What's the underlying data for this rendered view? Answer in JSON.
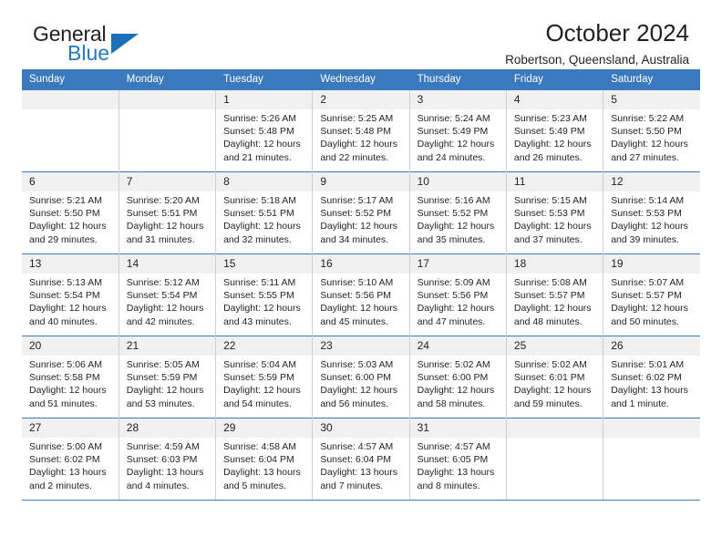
{
  "brand": {
    "name_part1": "General",
    "name_part2": "Blue",
    "accent_color": "#1a6fb5"
  },
  "header": {
    "title": "October 2024",
    "subtitle": "Robertson, Queensland, Australia"
  },
  "theme": {
    "header_row_color": "#3a79bd",
    "daynum_band_color": "#f0f0f0",
    "text_color": "#231f20"
  },
  "weekday_headers": [
    "Sunday",
    "Monday",
    "Tuesday",
    "Wednesday",
    "Thursday",
    "Friday",
    "Saturday"
  ],
  "weeks": [
    [
      {
        "day": "",
        "sunrise": "",
        "sunset": "",
        "daylight_line1": "",
        "daylight_line2": ""
      },
      {
        "day": "",
        "sunrise": "",
        "sunset": "",
        "daylight_line1": "",
        "daylight_line2": ""
      },
      {
        "day": "1",
        "sunrise": "Sunrise: 5:26 AM",
        "sunset": "Sunset: 5:48 PM",
        "daylight_line1": "Daylight: 12 hours",
        "daylight_line2": "and 21 minutes."
      },
      {
        "day": "2",
        "sunrise": "Sunrise: 5:25 AM",
        "sunset": "Sunset: 5:48 PM",
        "daylight_line1": "Daylight: 12 hours",
        "daylight_line2": "and 22 minutes."
      },
      {
        "day": "3",
        "sunrise": "Sunrise: 5:24 AM",
        "sunset": "Sunset: 5:49 PM",
        "daylight_line1": "Daylight: 12 hours",
        "daylight_line2": "and 24 minutes."
      },
      {
        "day": "4",
        "sunrise": "Sunrise: 5:23 AM",
        "sunset": "Sunset: 5:49 PM",
        "daylight_line1": "Daylight: 12 hours",
        "daylight_line2": "and 26 minutes."
      },
      {
        "day": "5",
        "sunrise": "Sunrise: 5:22 AM",
        "sunset": "Sunset: 5:50 PM",
        "daylight_line1": "Daylight: 12 hours",
        "daylight_line2": "and 27 minutes."
      }
    ],
    [
      {
        "day": "6",
        "sunrise": "Sunrise: 5:21 AM",
        "sunset": "Sunset: 5:50 PM",
        "daylight_line1": "Daylight: 12 hours",
        "daylight_line2": "and 29 minutes."
      },
      {
        "day": "7",
        "sunrise": "Sunrise: 5:20 AM",
        "sunset": "Sunset: 5:51 PM",
        "daylight_line1": "Daylight: 12 hours",
        "daylight_line2": "and 31 minutes."
      },
      {
        "day": "8",
        "sunrise": "Sunrise: 5:18 AM",
        "sunset": "Sunset: 5:51 PM",
        "daylight_line1": "Daylight: 12 hours",
        "daylight_line2": "and 32 minutes."
      },
      {
        "day": "9",
        "sunrise": "Sunrise: 5:17 AM",
        "sunset": "Sunset: 5:52 PM",
        "daylight_line1": "Daylight: 12 hours",
        "daylight_line2": "and 34 minutes."
      },
      {
        "day": "10",
        "sunrise": "Sunrise: 5:16 AM",
        "sunset": "Sunset: 5:52 PM",
        "daylight_line1": "Daylight: 12 hours",
        "daylight_line2": "and 35 minutes."
      },
      {
        "day": "11",
        "sunrise": "Sunrise: 5:15 AM",
        "sunset": "Sunset: 5:53 PM",
        "daylight_line1": "Daylight: 12 hours",
        "daylight_line2": "and 37 minutes."
      },
      {
        "day": "12",
        "sunrise": "Sunrise: 5:14 AM",
        "sunset": "Sunset: 5:53 PM",
        "daylight_line1": "Daylight: 12 hours",
        "daylight_line2": "and 39 minutes."
      }
    ],
    [
      {
        "day": "13",
        "sunrise": "Sunrise: 5:13 AM",
        "sunset": "Sunset: 5:54 PM",
        "daylight_line1": "Daylight: 12 hours",
        "daylight_line2": "and 40 minutes."
      },
      {
        "day": "14",
        "sunrise": "Sunrise: 5:12 AM",
        "sunset": "Sunset: 5:54 PM",
        "daylight_line1": "Daylight: 12 hours",
        "daylight_line2": "and 42 minutes."
      },
      {
        "day": "15",
        "sunrise": "Sunrise: 5:11 AM",
        "sunset": "Sunset: 5:55 PM",
        "daylight_line1": "Daylight: 12 hours",
        "daylight_line2": "and 43 minutes."
      },
      {
        "day": "16",
        "sunrise": "Sunrise: 5:10 AM",
        "sunset": "Sunset: 5:56 PM",
        "daylight_line1": "Daylight: 12 hours",
        "daylight_line2": "and 45 minutes."
      },
      {
        "day": "17",
        "sunrise": "Sunrise: 5:09 AM",
        "sunset": "Sunset: 5:56 PM",
        "daylight_line1": "Daylight: 12 hours",
        "daylight_line2": "and 47 minutes."
      },
      {
        "day": "18",
        "sunrise": "Sunrise: 5:08 AM",
        "sunset": "Sunset: 5:57 PM",
        "daylight_line1": "Daylight: 12 hours",
        "daylight_line2": "and 48 minutes."
      },
      {
        "day": "19",
        "sunrise": "Sunrise: 5:07 AM",
        "sunset": "Sunset: 5:57 PM",
        "daylight_line1": "Daylight: 12 hours",
        "daylight_line2": "and 50 minutes."
      }
    ],
    [
      {
        "day": "20",
        "sunrise": "Sunrise: 5:06 AM",
        "sunset": "Sunset: 5:58 PM",
        "daylight_line1": "Daylight: 12 hours",
        "daylight_line2": "and 51 minutes."
      },
      {
        "day": "21",
        "sunrise": "Sunrise: 5:05 AM",
        "sunset": "Sunset: 5:59 PM",
        "daylight_line1": "Daylight: 12 hours",
        "daylight_line2": "and 53 minutes."
      },
      {
        "day": "22",
        "sunrise": "Sunrise: 5:04 AM",
        "sunset": "Sunset: 5:59 PM",
        "daylight_line1": "Daylight: 12 hours",
        "daylight_line2": "and 54 minutes."
      },
      {
        "day": "23",
        "sunrise": "Sunrise: 5:03 AM",
        "sunset": "Sunset: 6:00 PM",
        "daylight_line1": "Daylight: 12 hours",
        "daylight_line2": "and 56 minutes."
      },
      {
        "day": "24",
        "sunrise": "Sunrise: 5:02 AM",
        "sunset": "Sunset: 6:00 PM",
        "daylight_line1": "Daylight: 12 hours",
        "daylight_line2": "and 58 minutes."
      },
      {
        "day": "25",
        "sunrise": "Sunrise: 5:02 AM",
        "sunset": "Sunset: 6:01 PM",
        "daylight_line1": "Daylight: 12 hours",
        "daylight_line2": "and 59 minutes."
      },
      {
        "day": "26",
        "sunrise": "Sunrise: 5:01 AM",
        "sunset": "Sunset: 6:02 PM",
        "daylight_line1": "Daylight: 13 hours",
        "daylight_line2": "and 1 minute."
      }
    ],
    [
      {
        "day": "27",
        "sunrise": "Sunrise: 5:00 AM",
        "sunset": "Sunset: 6:02 PM",
        "daylight_line1": "Daylight: 13 hours",
        "daylight_line2": "and 2 minutes."
      },
      {
        "day": "28",
        "sunrise": "Sunrise: 4:59 AM",
        "sunset": "Sunset: 6:03 PM",
        "daylight_line1": "Daylight: 13 hours",
        "daylight_line2": "and 4 minutes."
      },
      {
        "day": "29",
        "sunrise": "Sunrise: 4:58 AM",
        "sunset": "Sunset: 6:04 PM",
        "daylight_line1": "Daylight: 13 hours",
        "daylight_line2": "and 5 minutes."
      },
      {
        "day": "30",
        "sunrise": "Sunrise: 4:57 AM",
        "sunset": "Sunset: 6:04 PM",
        "daylight_line1": "Daylight: 13 hours",
        "daylight_line2": "and 7 minutes."
      },
      {
        "day": "31",
        "sunrise": "Sunrise: 4:57 AM",
        "sunset": "Sunset: 6:05 PM",
        "daylight_line1": "Daylight: 13 hours",
        "daylight_line2": "and 8 minutes."
      },
      {
        "day": "",
        "sunrise": "",
        "sunset": "",
        "daylight_line1": "",
        "daylight_line2": ""
      },
      {
        "day": "",
        "sunrise": "",
        "sunset": "",
        "daylight_line1": "",
        "daylight_line2": ""
      }
    ]
  ]
}
